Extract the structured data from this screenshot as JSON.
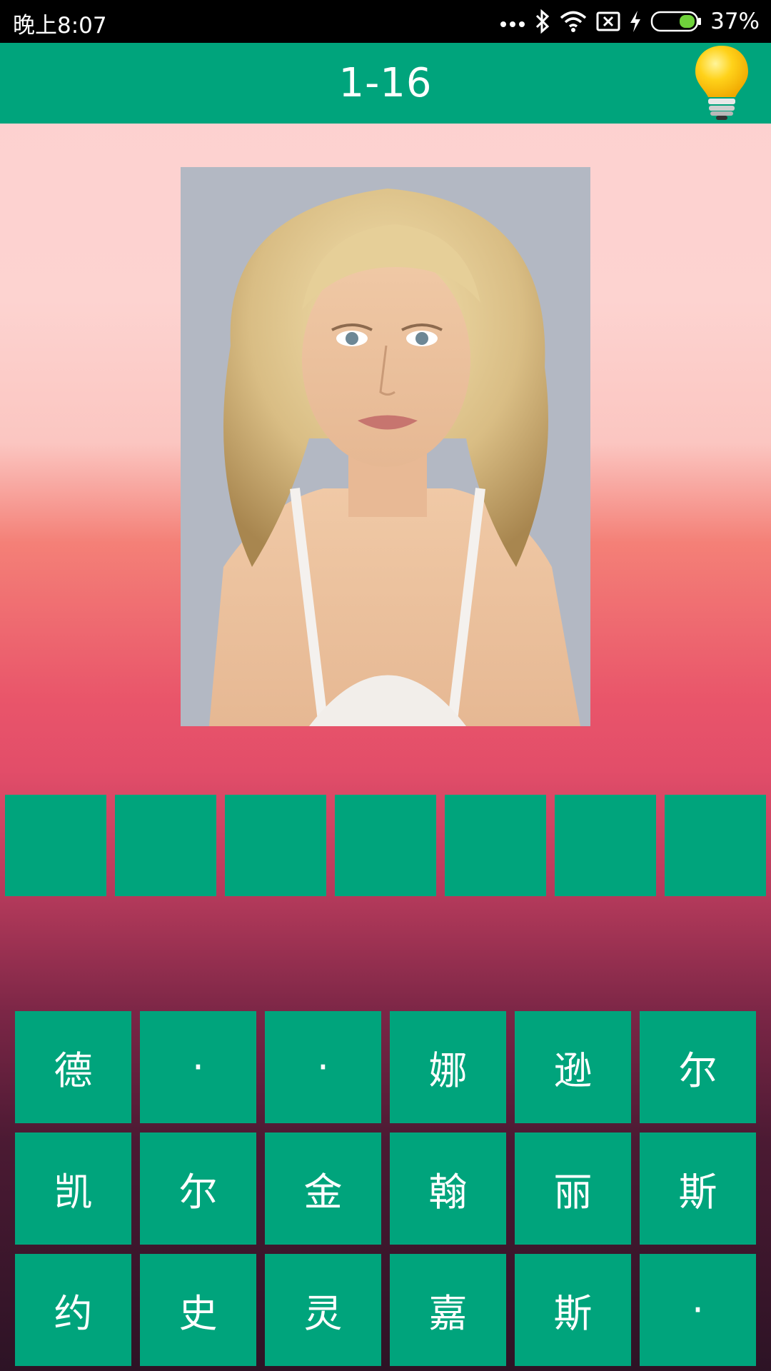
{
  "status_bar": {
    "time": "晚上8:07",
    "battery_percent": "37%",
    "battery_level": 0.37,
    "icons": [
      "more-dots-icon",
      "bluetooth-icon",
      "wifi-icon",
      "no-sim-icon",
      "charging-icon",
      "battery-icon"
    ]
  },
  "header": {
    "level": "1-16",
    "hint_icon": "lightbulb-icon",
    "color": "#00a47c"
  },
  "answer": {
    "slots": [
      "",
      "",
      "",
      "",
      "",
      "",
      ""
    ]
  },
  "keyboard": {
    "rows": [
      [
        "德",
        "·",
        "·",
        "娜",
        "逊",
        "尔"
      ],
      [
        "凯",
        "尔",
        "金",
        "翰",
        "丽",
        "斯"
      ],
      [
        "约",
        "史",
        "灵",
        "嘉",
        "斯",
        "·"
      ]
    ]
  }
}
